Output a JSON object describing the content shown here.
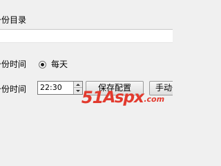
{
  "backup": {
    "dir_label": "备份目录",
    "folder_value": "",
    "mode_label": "备份时间",
    "mode_option": "每天",
    "mode_selected": true,
    "time_label": "备份时间",
    "time_value": "22:30",
    "save_button": "保存配置",
    "manual_button": "手动备份"
  },
  "watermark": {
    "number": "51",
    "word": "Aspx",
    "domain": ".com"
  },
  "colors": {
    "background": "#f0f0f0",
    "watermark": "#e23a2e"
  },
  "icons": {
    "spin_up": "triangle-up-icon",
    "spin_down": "triangle-down-icon",
    "radio": "radio-selected-icon"
  }
}
